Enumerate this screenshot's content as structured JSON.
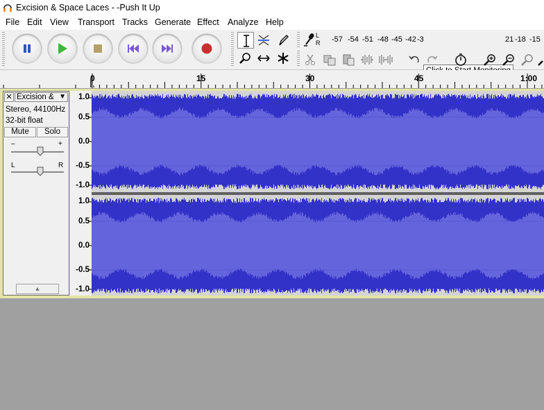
{
  "window": {
    "title": "Excision & Space Laces - -Push It Up"
  },
  "menu": [
    "File",
    "Edit",
    "View",
    "Transport",
    "Tracks",
    "Generate",
    "Effect",
    "Analyze",
    "Help"
  ],
  "transport": {
    "buttons": [
      {
        "name": "pause",
        "icon": "pause-icon"
      },
      {
        "name": "play",
        "icon": "play-icon"
      },
      {
        "name": "stop",
        "icon": "stop-icon"
      },
      {
        "name": "skip-start",
        "icon": "skip-to-start-icon"
      },
      {
        "name": "skip-end",
        "icon": "skip-to-end-icon"
      },
      {
        "name": "record",
        "icon": "record-icon"
      }
    ]
  },
  "tools": {
    "selected": "selection-tool",
    "icons": [
      "selection-tool-icon",
      "envelope-tool-icon",
      "draw-tool-icon",
      "zoom-tool-icon",
      "time-shift-tool-icon",
      "multi-tool-icon"
    ]
  },
  "meter": {
    "record_channel_labels": [
      "L",
      "R"
    ],
    "scale": [
      "-57",
      "-54",
      "-51",
      "-48",
      "-45",
      "-42",
      "-3"
    ],
    "scale_right": [
      "21",
      "-18",
      "-15"
    ],
    "tooltip": "Click to Start Monitoring"
  },
  "ruler": {
    "labels": [
      "0",
      "15",
      "30",
      "45",
      "1:00"
    ]
  },
  "track": {
    "name": "Excision &",
    "info_line1": "Stereo, 44100Hz",
    "info_line2": "32-bit float",
    "mute_label": "Mute",
    "solo_label": "Solo",
    "gain_minus": "–",
    "gain_plus": "+",
    "pan_left": "L",
    "pan_right": "R",
    "close_label": "✕",
    "menu_arrow": "▼",
    "collapse_arrow": "▲",
    "scale_labels": [
      "1.0",
      "0.5",
      "0.0",
      "-0.5",
      "-1.0"
    ]
  },
  "colors": {
    "waveform": "#3232c8",
    "waveform_rms": "#6464dc",
    "track_background": "#e4e4a8",
    "empty_area": "#a0a0a0"
  }
}
